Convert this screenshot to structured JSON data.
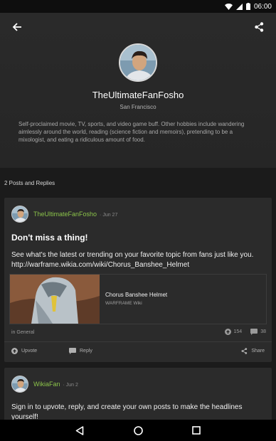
{
  "status_bar": {
    "time": "06:00",
    "icons": [
      "wifi-icon",
      "signal-icon",
      "battery-icon"
    ]
  },
  "header": {
    "back_icon": "arrow-left-icon",
    "share_icon": "share-icon",
    "username": "TheUltimateFanFosho",
    "location": "San Francisco",
    "bio": "Self-proclaimed movie, TV, sports, and video game buff. Other hobbies include wandering aimlessly around the world, reading (science fiction and memoirs), pretending to be a mixologist, and eating a ridiculous amount of food."
  },
  "posts_section": {
    "count_label": "2 Posts and Replies"
  },
  "posts": [
    {
      "author": "TheUltimateFanFosho",
      "date": "· Jun 27",
      "title": "Don't miss a thing!",
      "body": "See what's the latest or trending on your favorite topic from fans just like you. http://warframe.wikia.com/wiki/Chorus_Banshee_Helmet",
      "link_preview": {
        "title": "Chorus Banshee Helmet",
        "site": "WARFRAME Wiki"
      },
      "category": "in General",
      "upvotes": "154",
      "replies": "38",
      "actions": {
        "upvote": "Upvote",
        "reply": "Reply",
        "share": "Share"
      }
    },
    {
      "author": "WikiaFan",
      "date": "· Jun 2",
      "body": "Sign in to upvote, reply, and create your own posts to make the headlines yourself!"
    }
  ],
  "colors": {
    "accent": "#8bc34a",
    "background": "#1b1b1b",
    "card": "#2b2b2b",
    "header": "#282828"
  },
  "nav_bar": {
    "icons": [
      "back-triangle-icon",
      "home-circle-icon",
      "recents-square-icon"
    ]
  }
}
